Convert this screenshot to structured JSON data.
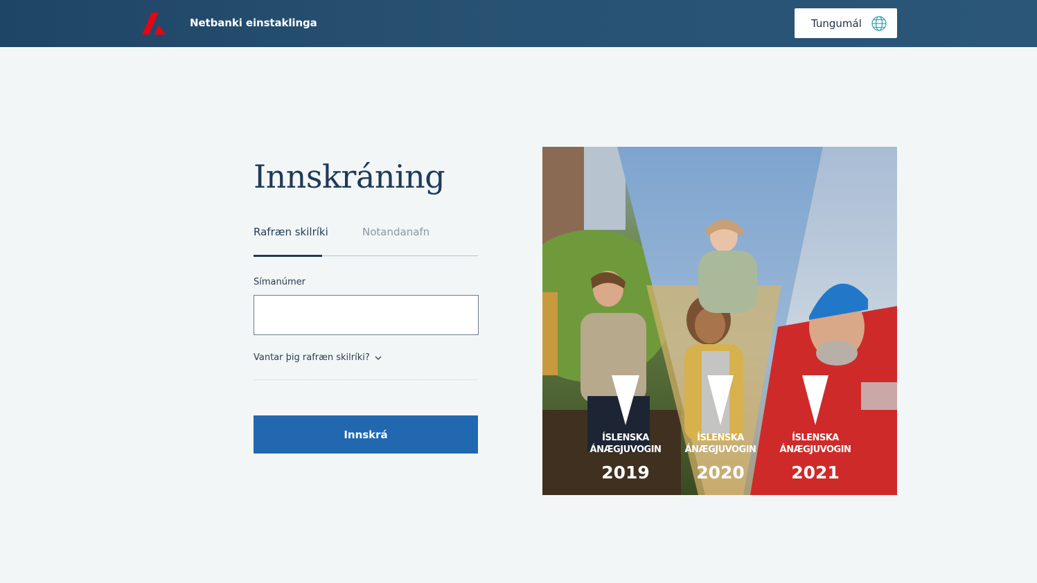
{
  "header": {
    "app_title": "Netbanki einstaklinga",
    "language_button": "Tungumál",
    "brand_color": "#e30613"
  },
  "login": {
    "title": "Innskráning",
    "tabs": [
      {
        "label": "Rafræn skilríki",
        "active": true
      },
      {
        "label": "Notandanafn",
        "active": false
      }
    ],
    "phone_label": "Símanúmer",
    "phone_value": "",
    "help_toggle": "Vantar þig rafræn skilríki?",
    "submit_label": "Innskrá",
    "accent": "#2168b0"
  },
  "promo": {
    "awards": [
      {
        "line1": "ÍSLENSKA",
        "line2": "ÁNÆGJUVOGIN",
        "year": "2019"
      },
      {
        "line1": "ÍSLENSKA",
        "line2": "ÁNÆGJUVOGIN",
        "year": "2020"
      },
      {
        "line1": "ÍSLENSKA",
        "line2": "ÁNÆGJUVOGIN",
        "year": "2021"
      }
    ]
  }
}
